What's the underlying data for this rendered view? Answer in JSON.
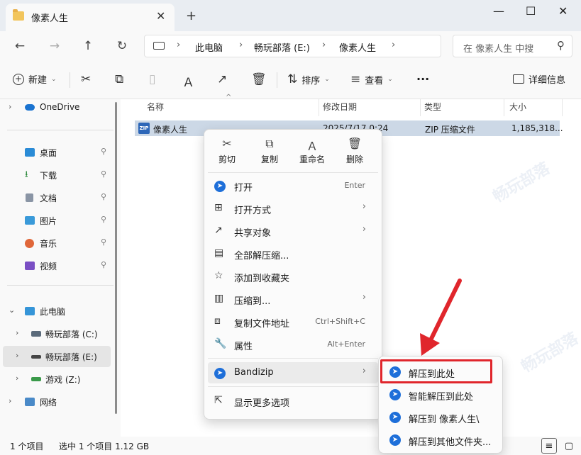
{
  "window": {
    "tab_title": "像素人生",
    "tab_close": "✕",
    "new_tab": "+",
    "minimize": "—",
    "maximize": "☐",
    "close": "✕"
  },
  "nav": {
    "back": "←",
    "forward": "→",
    "up": "↑",
    "refresh": "↻"
  },
  "address": {
    "segments": [
      "此电脑",
      "畅玩部落 (E:)",
      "像素人生"
    ],
    "sep": "›"
  },
  "search": {
    "placeholder": "在 像素人生 中搜"
  },
  "toolbar": {
    "new_label": "新建",
    "sort_label": "排序",
    "view_label": "查看",
    "more": "···",
    "details_label": "详细信息"
  },
  "sidebar": {
    "items": [
      {
        "label": "OneDrive"
      },
      {
        "label": "桌面"
      },
      {
        "label": "下载"
      },
      {
        "label": "文档"
      },
      {
        "label": "图片"
      },
      {
        "label": "音乐"
      },
      {
        "label": "视频"
      },
      {
        "label": "此电脑"
      },
      {
        "label": "畅玩部落 (C:)"
      },
      {
        "label": "畅玩部落 (E:)"
      },
      {
        "label": "游戏 (Z:)"
      },
      {
        "label": "网络"
      }
    ]
  },
  "columns": {
    "name": "名称",
    "modified": "修改日期",
    "type": "类型",
    "size": "大小"
  },
  "file": {
    "name": "像素人生",
    "modified": "2025/7/17 0:24",
    "type": "ZIP 压缩文件",
    "size": "1,185,318..."
  },
  "status": {
    "count": "1 个项目",
    "selected": "选中 1 个项目  1.12 GB"
  },
  "context_menu": {
    "top_actions": [
      "剪切",
      "复制",
      "重命名",
      "删除"
    ],
    "items": [
      {
        "label": "打开",
        "shortcut": "Enter"
      },
      {
        "label": "打开方式",
        "has_sub": true
      },
      {
        "label": "共享对象",
        "has_sub": true
      },
      {
        "label": "全部解压缩..."
      },
      {
        "label": "添加到收藏夹"
      },
      {
        "label": "压缩到...",
        "has_sub": true
      },
      {
        "label": "复制文件地址",
        "shortcut": "Ctrl+Shift+C"
      },
      {
        "label": "属性",
        "shortcut": "Alt+Enter"
      },
      {
        "label": "Bandizip",
        "has_sub": true
      },
      {
        "label": "显示更多选项"
      }
    ],
    "submenu_arrow": "›"
  },
  "submenu": {
    "items": [
      "解压到此处",
      "智能解压到此处",
      "解压到 像素人生\\",
      "解压到其他文件夹..."
    ]
  },
  "watermark": "畅玩部落",
  "colors": {
    "selection": "#ccd8e6",
    "accent": "#1e6fd9",
    "highlight": "#e0262c"
  }
}
